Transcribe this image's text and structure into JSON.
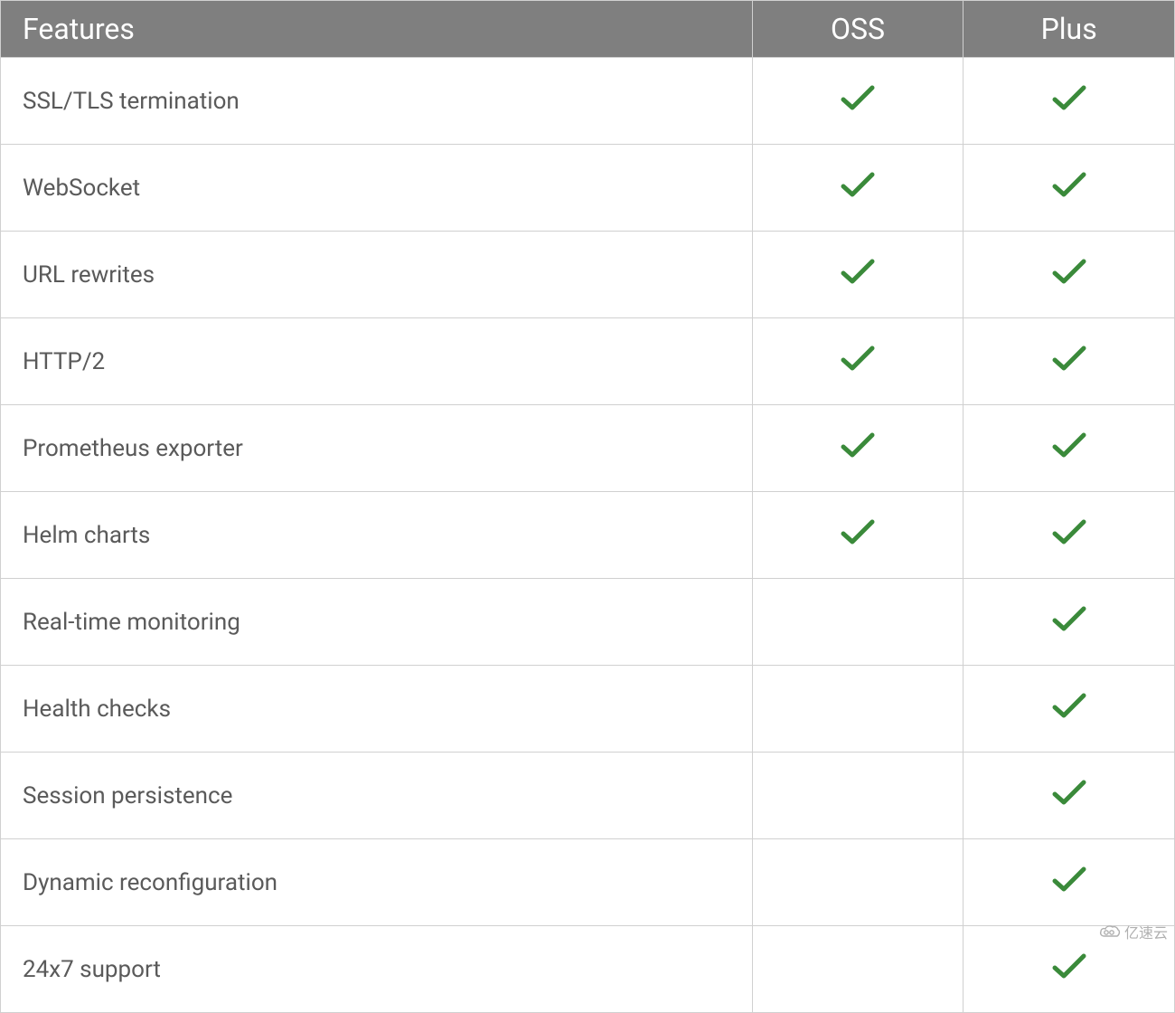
{
  "table": {
    "headers": {
      "features": "Features",
      "oss": "OSS",
      "plus": "Plus"
    },
    "rows": [
      {
        "feature": "SSL/TLS termination",
        "oss": true,
        "plus": true
      },
      {
        "feature": "WebSocket",
        "oss": true,
        "plus": true
      },
      {
        "feature": "URL rewrites",
        "oss": true,
        "plus": true
      },
      {
        "feature": "HTTP/2",
        "oss": true,
        "plus": true
      },
      {
        "feature": "Prometheus exporter",
        "oss": true,
        "plus": true
      },
      {
        "feature": "Helm charts",
        "oss": true,
        "plus": true
      },
      {
        "feature": "Real-time monitoring",
        "oss": false,
        "plus": true
      },
      {
        "feature": "Health checks",
        "oss": false,
        "plus": true
      },
      {
        "feature": "Session persistence",
        "oss": false,
        "plus": true
      },
      {
        "feature": "Dynamic reconfiguration",
        "oss": false,
        "plus": true
      },
      {
        "feature": "24x7 support",
        "oss": false,
        "plus": true
      }
    ]
  },
  "watermark": {
    "text": "亿速云"
  },
  "colors": {
    "check": "#3a8a3a",
    "header_bg": "#7f7f7f"
  },
  "chart_data": {
    "type": "table",
    "title": "Feature comparison: OSS vs Plus",
    "columns": [
      "Features",
      "OSS",
      "Plus"
    ],
    "rows": [
      [
        "SSL/TLS termination",
        "yes",
        "yes"
      ],
      [
        "WebSocket",
        "yes",
        "yes"
      ],
      [
        "URL rewrites",
        "yes",
        "yes"
      ],
      [
        "HTTP/2",
        "yes",
        "yes"
      ],
      [
        "Prometheus exporter",
        "yes",
        "yes"
      ],
      [
        "Helm charts",
        "yes",
        "yes"
      ],
      [
        "Real-time monitoring",
        "",
        "yes"
      ],
      [
        "Health checks",
        "",
        "yes"
      ],
      [
        "Session persistence",
        "",
        "yes"
      ],
      [
        "Dynamic reconfiguration",
        "",
        "yes"
      ],
      [
        "24x7 support",
        "",
        "yes"
      ]
    ]
  }
}
